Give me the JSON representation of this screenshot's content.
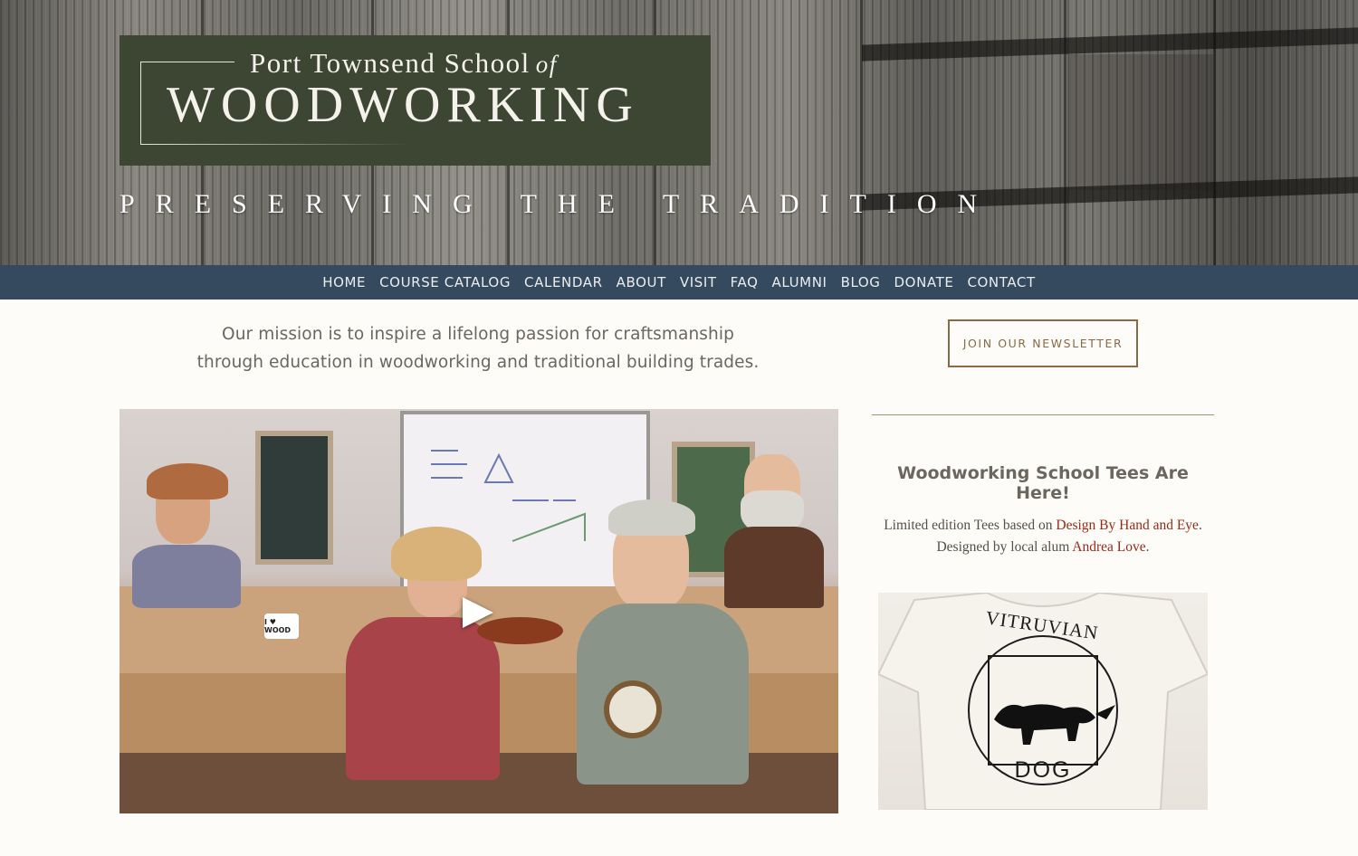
{
  "header": {
    "logo_line1": "Port Townsend School",
    "logo_of": "of",
    "logo_line2": "WOODWORKING",
    "tagline": "PRESERVING THE TRADITION"
  },
  "nav": {
    "items": [
      "HOME",
      "COURSE CATALOG",
      "CALENDAR",
      "ABOUT",
      "VISIT",
      "FAQ",
      "ALUMNI",
      "BLOG",
      "DONATE",
      "CONTACT"
    ]
  },
  "main": {
    "mission": "Our mission is to inspire a lifelong passion for craftsmanship through education in woodworking and traditional building trades.",
    "video": {
      "mug_text": "I ♥ WOOD"
    }
  },
  "sidebar": {
    "newsletter_label": "JOIN OUR NEWSLETTER",
    "tees_title": "Woodworking School Tees Are Here!",
    "tees_desc_pre": "Limited edition Tees based on ",
    "tees_link1": "Design By Hand and Eye",
    "tees_desc_mid": ". Designed by local alum ",
    "tees_link2": "Andrea Love",
    "tees_desc_post": ".",
    "tee_text_top": "VITRUVIAN",
    "tee_text_bottom": "DOG"
  },
  "colors": {
    "logo_bg": "#3d4533",
    "nav_bg": "#354a5e",
    "accent_brown": "#8a6a45",
    "link_red": "#9a2a17"
  }
}
